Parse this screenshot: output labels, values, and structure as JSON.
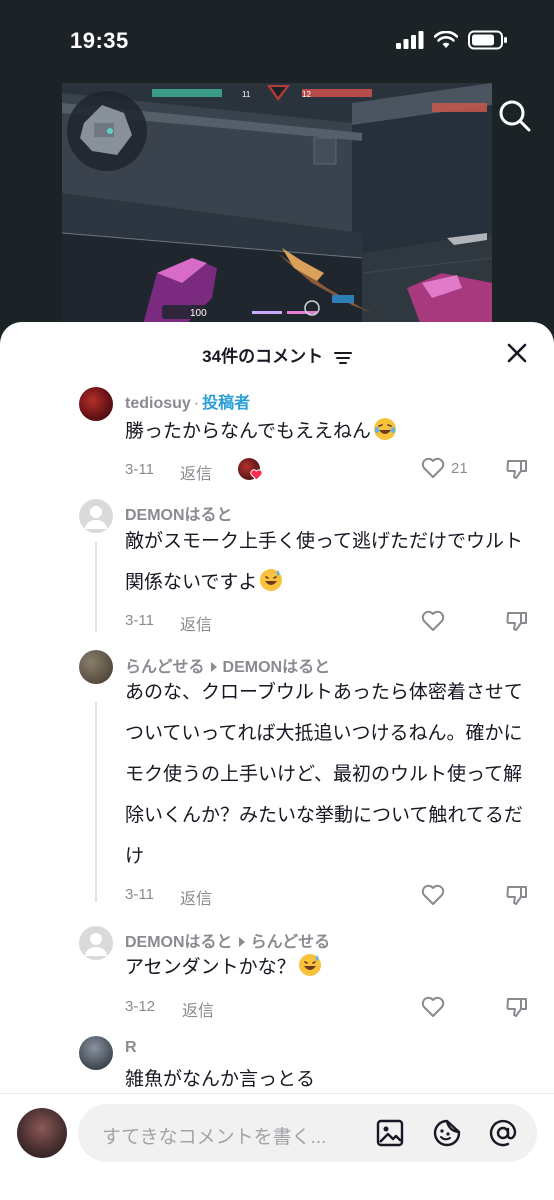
{
  "status_bar": {
    "time": "19:35"
  },
  "sheet": {
    "title": "34件のコメント"
  },
  "comments": [
    {
      "user": "tediosuy",
      "author_badge": "投稿者",
      "text": "勝ったからなんでもええねん",
      "date": "3-11",
      "reply": "返信",
      "likes": "21"
    },
    {
      "user": "DEMONはると",
      "text": "敵がスモーク上手く使って逃げただけでウルト関係ないですよ",
      "date": "3-11",
      "reply": "返信"
    },
    {
      "user": "らんどせる",
      "reply_to": "DEMONはると",
      "text": "あのな、クローブウルトあったら体密着させてついていってれば大抵追いつけるねん。確かにモク使うの上手いけど、最初のウルト使って解除いくんか？みたいな挙動について触れてるだけ",
      "date": "3-11",
      "reply": "返信"
    },
    {
      "user": "DEMONはると",
      "reply_to": "らんどせる",
      "text": "アセンダントかな？",
      "date": "3-12",
      "reply": "返信"
    },
    {
      "user": "R",
      "text": "雑魚がなんか言っとる"
    }
  ],
  "input": {
    "placeholder": "すてきなコメントを書く..."
  },
  "hud": {
    "left_count": "11",
    "right_count": "12",
    "health": "100"
  },
  "colors": {
    "accent_blue": "#2a9fd6",
    "dark_bg": "#1b2326"
  }
}
